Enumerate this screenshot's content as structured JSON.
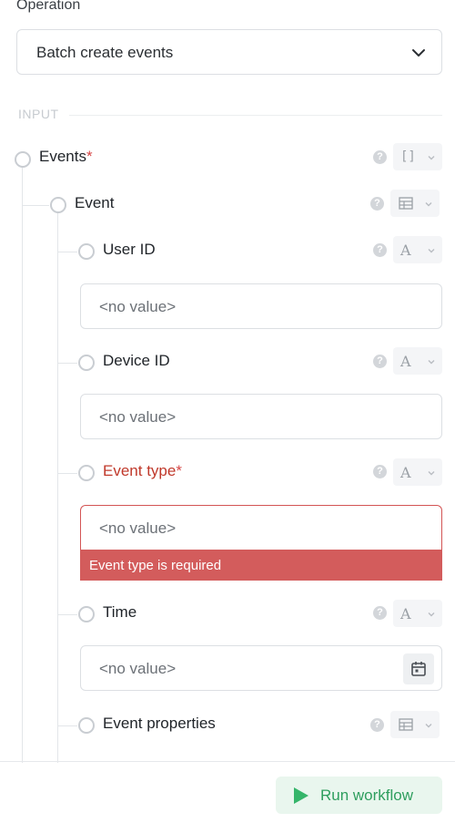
{
  "operation": {
    "label": "Operation",
    "value": "Batch create events"
  },
  "section": {
    "input_label": "INPUT"
  },
  "fields": {
    "events": {
      "label": "Events",
      "required_mark": "*",
      "type_glyph": "[]"
    },
    "event": {
      "label": "Event",
      "type_glyph": "table"
    },
    "user_id": {
      "label": "User ID",
      "type_glyph": "A",
      "placeholder": "<no value>"
    },
    "device_id": {
      "label": "Device ID",
      "type_glyph": "A",
      "placeholder": "<no value>"
    },
    "event_type": {
      "label": "Event type",
      "required_mark": "*",
      "type_glyph": "A",
      "placeholder": "<no value>",
      "error": "Event type is required"
    },
    "time": {
      "label": "Time",
      "type_glyph": "A",
      "placeholder": "<no value>"
    },
    "event_properties": {
      "label": "Event properties",
      "type_glyph": "table"
    }
  },
  "help_glyph": "?",
  "footer": {
    "run_label": "Run workflow"
  },
  "colors": {
    "error": "#d35c5c",
    "accent_green": "#35b56a",
    "border": "#dcdfe3"
  }
}
